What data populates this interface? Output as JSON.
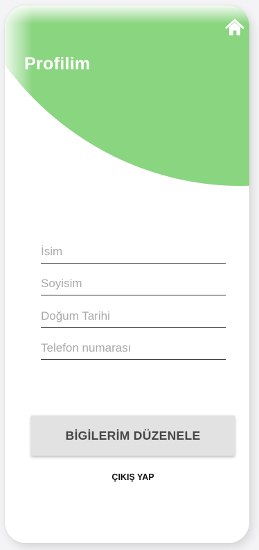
{
  "header": {
    "title": "Profilim",
    "home_icon": "home-icon",
    "background_color": "#8ad580"
  },
  "form": {
    "name_placeholder": "İsim",
    "surname_placeholder": "Soyisim",
    "birthdate_placeholder": "Doğum Tarihi",
    "phone_placeholder": "Telefon numarası"
  },
  "actions": {
    "edit_label": "BİGİLERİM DÜZENELE",
    "logout_label": "ÇIKIŞ YAP"
  }
}
